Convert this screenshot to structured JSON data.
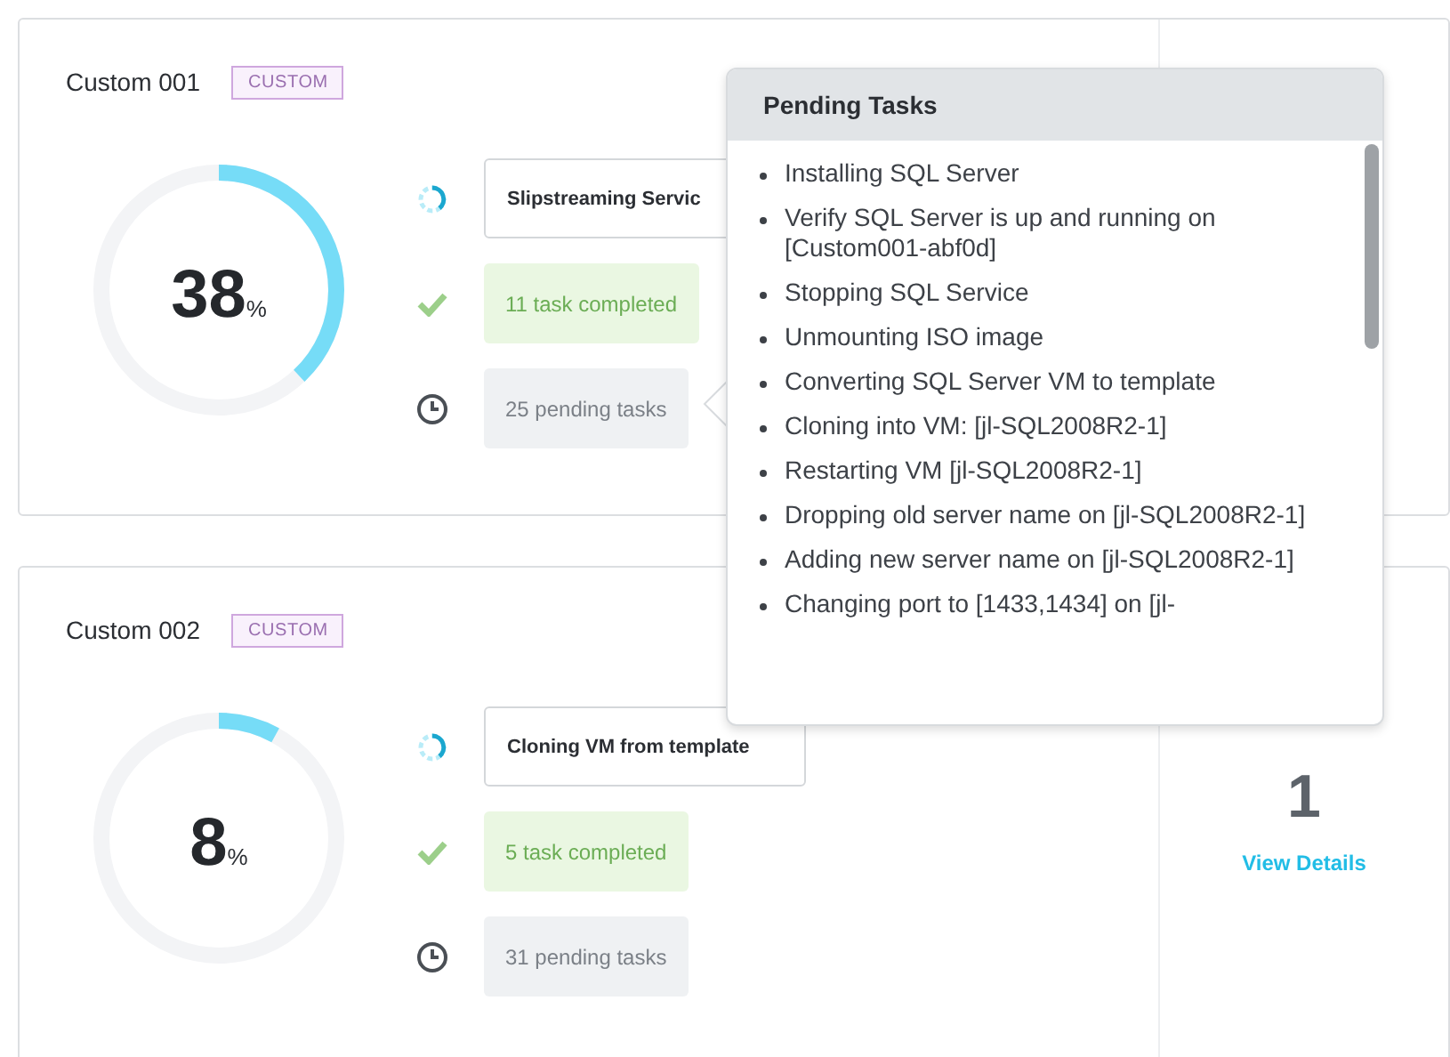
{
  "cards": [
    {
      "title": "Custom 001",
      "badge": "CUSTOM",
      "level": 0.38,
      "percent": "38",
      "percent_sign": "%",
      "current_task": "Slipstreaming Servic",
      "completed": "11 task completed",
      "pending": "25 pending tasks"
    },
    {
      "title": "Custom 002",
      "badge": "CUSTOM",
      "level": 0.08,
      "percent": "8",
      "percent_sign": "%",
      "current_task": "Cloning VM from template",
      "completed": "5 task completed",
      "pending": "31 pending tasks",
      "vm_count": "1",
      "link": "View Details"
    }
  ],
  "popover": {
    "title": "Pending Tasks",
    "items": [
      "Installing SQL Server",
      "Verify SQL Server is up and running on [Custom001-abf0d]",
      "Stopping SQL Service",
      "Unmounting ISO image",
      "Converting SQL Server VM to template",
      "Cloning into VM: [jl-SQL2008R2-1]",
      "Restarting VM [jl-SQL2008R2-1]",
      "Dropping old server name on [jl-SQL2008R2-1]",
      "Adding new server name on [jl-SQL2008R2-1]",
      "Changing port to [1433,1434] on [jl-"
    ]
  }
}
